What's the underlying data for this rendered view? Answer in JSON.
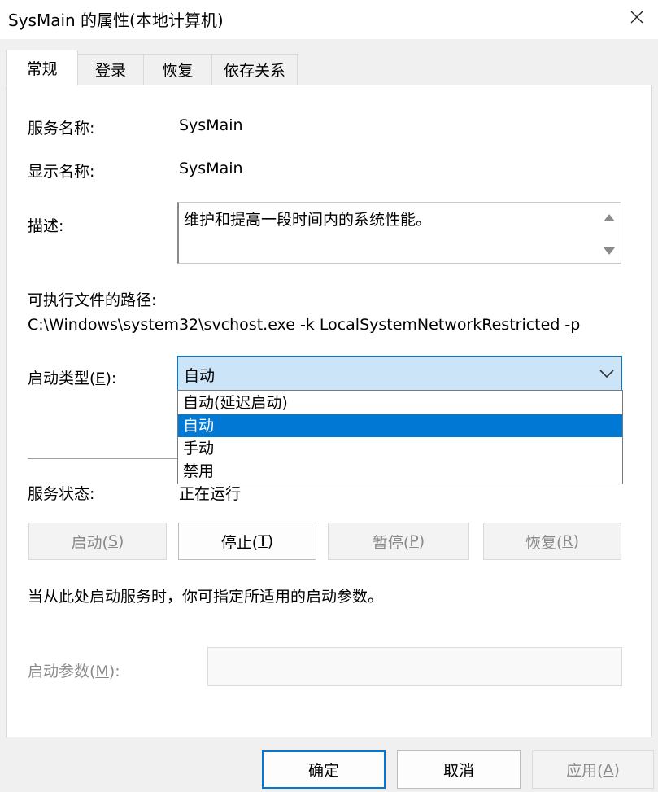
{
  "window": {
    "title": "SysMain 的属性(本地计算机)"
  },
  "tabs": [
    {
      "label": "常规"
    },
    {
      "label": "登录"
    },
    {
      "label": "恢复"
    },
    {
      "label": "依存关系"
    }
  ],
  "general": {
    "service_name_label": "服务名称:",
    "service_name_value": "SysMain",
    "display_name_label": "显示名称:",
    "display_name_value": "SysMain",
    "description_label": "描述:",
    "description_value": "维护和提高一段时间内的系统性能。",
    "exe_path_label": "可执行文件的路径:",
    "exe_path_value": "C:\\Windows\\system32\\svchost.exe -k LocalSystemNetworkRestricted -p",
    "startup_type_label_pre": "启动类型(",
    "startup_type_label_key": "E",
    "startup_type_label_post": "):",
    "startup_type_value": "自动",
    "startup_options": [
      {
        "label": "自动(延迟启动)"
      },
      {
        "label": "自动"
      },
      {
        "label": "手动"
      },
      {
        "label": "禁用"
      }
    ],
    "service_status_label": "服务状态:",
    "service_status_value": "正在运行",
    "buttons": {
      "start_pre": "启动(",
      "start_key": "S",
      "start_post": ")",
      "stop_pre": "停止(",
      "stop_key": "T",
      "stop_post": ")",
      "pause_pre": "暂停(",
      "pause_key": "P",
      "pause_post": ")",
      "resume_pre": "恢复(",
      "resume_key": "R",
      "resume_post": ")"
    },
    "hint_text": "当从此处启动服务时，你可指定所适用的启动参数。",
    "start_params_label_pre": "启动参数(",
    "start_params_label_key": "M",
    "start_params_label_post": "):",
    "start_params_value": ""
  },
  "footer": {
    "ok": "确定",
    "cancel": "取消",
    "apply_pre": "应用(",
    "apply_key": "A",
    "apply_post": ")"
  },
  "colors": {
    "accent": "#0078d4",
    "combo_bg": "#cce4f7",
    "disabled_text": "#8a8a8a"
  },
  "icons": {
    "close": "close-icon",
    "dropdown": "chevron-down-icon",
    "scroll_up": "scroll-up-arrow-icon",
    "scroll_down": "scroll-down-arrow-icon"
  }
}
